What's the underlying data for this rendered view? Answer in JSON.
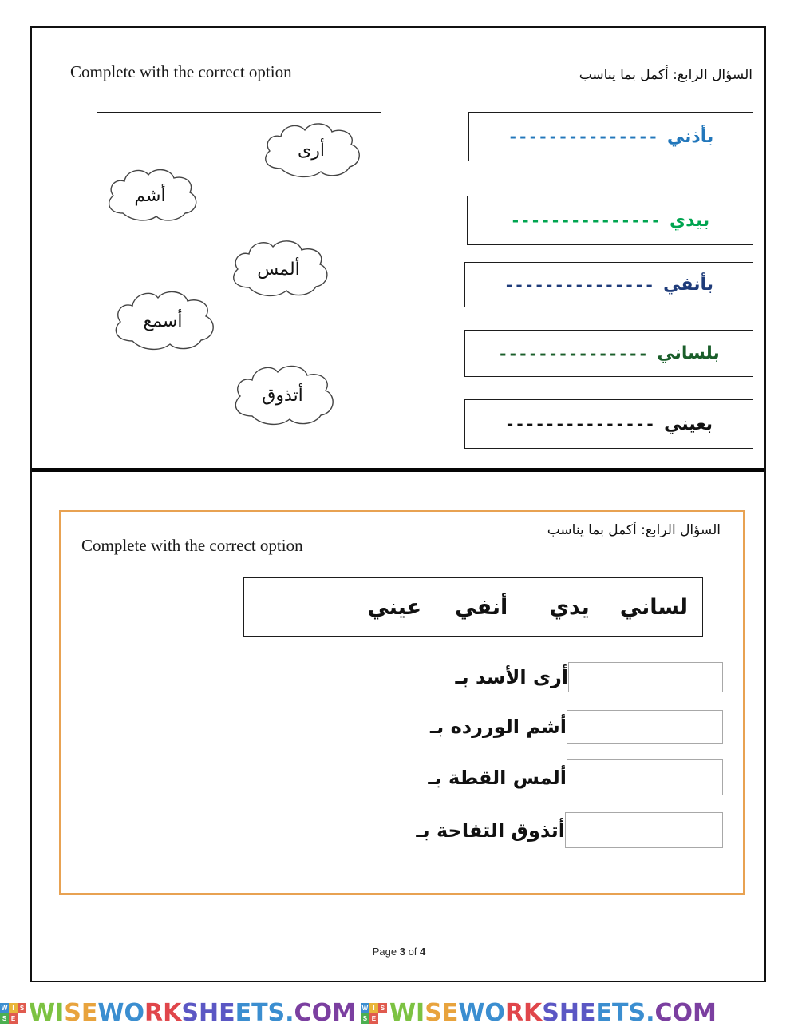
{
  "page": {
    "footer_prefix": "Page ",
    "footer_page": "3",
    "footer_middle": " of ",
    "footer_total": "4"
  },
  "top_section": {
    "en_heading": "Complete with the correct option",
    "ar_heading": "السؤال الرابع: أكمل بما يناسب",
    "clouds": [
      {
        "label": "أرى"
      },
      {
        "label": "أشم"
      },
      {
        "label": "ألمس"
      },
      {
        "label": "أسمع"
      },
      {
        "label": "أتذوق"
      }
    ],
    "answers": [
      {
        "word": "بأذني",
        "dashes": "---------------",
        "color": "#2277BB"
      },
      {
        "word": "بيدي",
        "dashes": "---------------",
        "color": "#00A550"
      },
      {
        "word": "بأنفي",
        "dashes": "---------------",
        "color": "#1F3C7A"
      },
      {
        "word": "بلساني",
        "dashes": "---------------",
        "color": "#1A5E2A"
      },
      {
        "word": "بعيني",
        "dashes": "---------------",
        "color": "#111111"
      }
    ]
  },
  "bottom_section": {
    "ar_heading": "السؤال الرابع: أكمل بما يناسب",
    "en_heading": "Complete with the correct option",
    "word_bank": [
      "لساني",
      "يدي",
      "أنفي",
      "عيني"
    ],
    "sentences": [
      {
        "text": "أرى الأسد بـ"
      },
      {
        "text": "أشم الوررده بـ"
      },
      {
        "text": "ألمس القطة بـ"
      },
      {
        "text": "أتذوق التفاحة بـ"
      }
    ]
  },
  "watermark": {
    "logo_letters": [
      "W",
      "I",
      "S",
      "S",
      "E",
      ""
    ],
    "logo_colors": [
      "#3B8ED0",
      "#E8B53A",
      "#E05A4E",
      "#4CAF50",
      "#E05A4E",
      "#ffffff"
    ],
    "text": "WISEWORKSHEETS.COM",
    "letter_colors": [
      "#7CC242",
      "#7CC242",
      "#E8A33D",
      "#E8A33D",
      "#3B8ED0",
      "#3B8ED0",
      "#E0464B",
      "#E0464B",
      "#5B57C4",
      "#5B57C4",
      "#5B57C4",
      "#3B8ED0",
      "#3B8ED0",
      "#3B8ED0",
      "#3B8ED0",
      "#7B3FA0",
      "#7B3FA0",
      "#7B3FA0"
    ]
  }
}
